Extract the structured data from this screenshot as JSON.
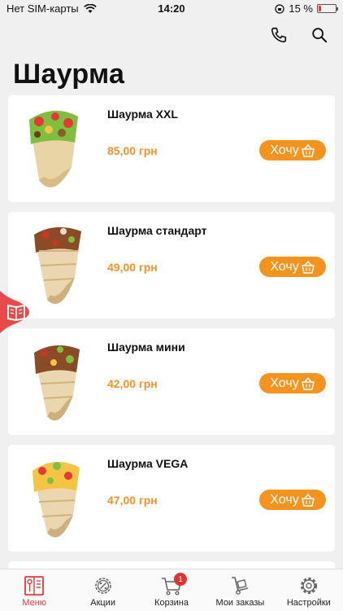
{
  "status_bar": {
    "carrier": "Нет SIM-карты",
    "time": "14:20",
    "battery_percent_text": "15 %",
    "battery_level": 0.15
  },
  "header": {
    "title": "Шаурма",
    "icons": [
      "phone-icon",
      "search-icon"
    ]
  },
  "products": [
    {
      "name": "Шаурма XXL",
      "price": "85,00 грн",
      "button": "Хочу"
    },
    {
      "name": "Шаурма стандарт",
      "price": "49,00 грн",
      "button": "Хочу"
    },
    {
      "name": "Шаурма мини",
      "price": "42,00 грн",
      "button": "Хочу"
    },
    {
      "name": "Шаурма VEGA",
      "price": "47,00 грн",
      "button": "Хочу"
    }
  ],
  "tabbar": {
    "items": [
      {
        "label": "Меню",
        "icon": "menu-book-icon",
        "active": true
      },
      {
        "label": "Акции",
        "icon": "discount-gear-icon",
        "active": false
      },
      {
        "label": "Корзина",
        "icon": "cart-icon",
        "active": false,
        "badge": "1"
      },
      {
        "label": "Мои заказы",
        "icon": "hand-truck-icon",
        "active": false
      },
      {
        "label": "Настройки",
        "icon": "settings-gear-icon",
        "active": false
      }
    ]
  },
  "colors": {
    "accent_orange": "#f5931f",
    "price_orange": "#f2932a",
    "active_red": "#e23a3a",
    "side_tab_red": "#e84a4a"
  }
}
